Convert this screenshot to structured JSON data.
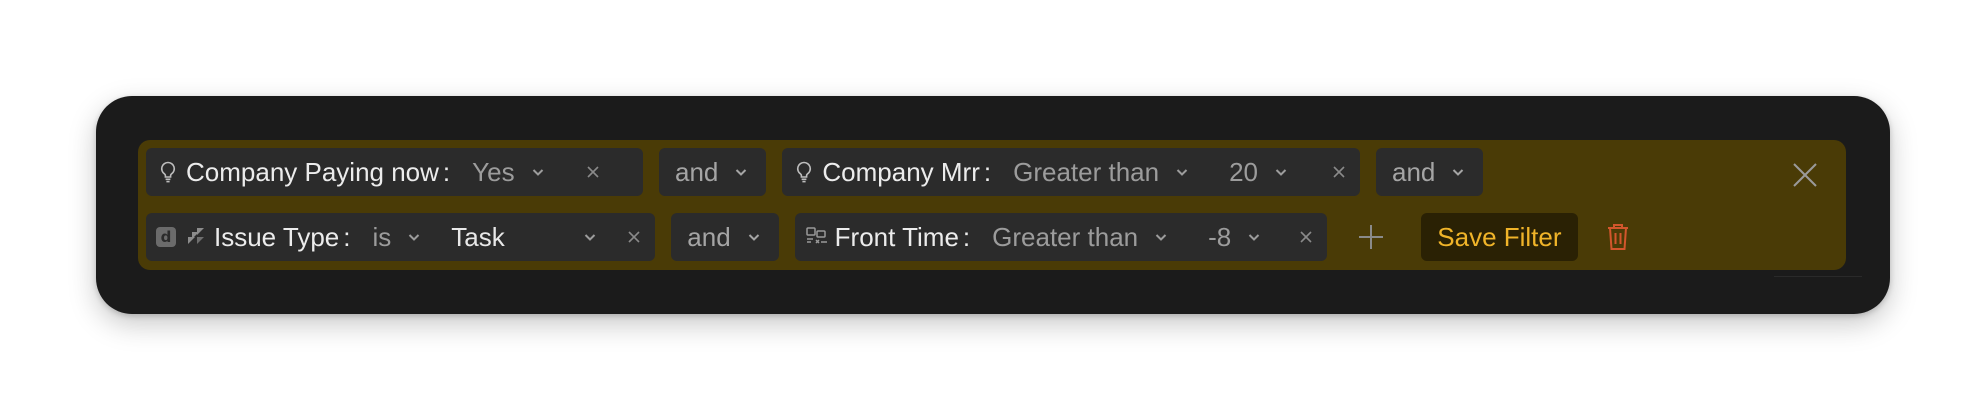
{
  "colors": {
    "panel_background": "#1b1b1b",
    "filter_area_background": "#4a3b06",
    "chip_background": "#2b2b2b",
    "save_text": "#f0b429",
    "delete_icon": "#d2562c"
  },
  "filters": {
    "row1": [
      {
        "icon": "lightbulb-icon",
        "label": "Company Paying now",
        "colon": ":",
        "operator": "",
        "value": "Yes"
      },
      {
        "conjunction": "and"
      },
      {
        "icon": "lightbulb-icon",
        "label": "Company Mrr",
        "colon": ":",
        "operator": "Greater than",
        "value": "20"
      },
      {
        "conjunction": "and"
      }
    ],
    "row2": [
      {
        "icon": "jira-icon",
        "badge": "d",
        "label": "Issue Type",
        "colon": ":",
        "operator": "is",
        "value": "Task"
      },
      {
        "conjunction": "and"
      },
      {
        "icon": "front-app-icon",
        "label": "Front Time",
        "colon": ":",
        "operator": "Greater than",
        "value": "-8"
      }
    ]
  },
  "actions": {
    "save_label": "Save Filter",
    "add_icon": "plus-icon",
    "delete_icon": "trash-icon",
    "close_icon": "close-icon"
  }
}
